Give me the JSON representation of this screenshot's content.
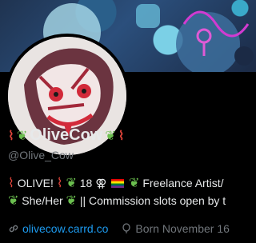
{
  "profile": {
    "display_name": "OliveCow",
    "handle": "@Olive_Cow",
    "bio_line1": {
      "name": "OLIVE!",
      "age": "18",
      "gender_symbol": "⚢",
      "role": "Freelance Artist/"
    },
    "bio_line2": {
      "pronouns": "She/Her",
      "rest": "|| Commission slots open by t"
    },
    "website": "olivecow.carrd.co",
    "born": "Born November 16"
  },
  "icons": {
    "pepper": "hot-pepper-icon",
    "herb": "herb-icon",
    "flag": "rainbow-flag-icon",
    "link": "link-icon",
    "balloon": "birthday-balloon-icon"
  },
  "colors": {
    "background": "#000000",
    "text": "#e7e9ea",
    "muted": "#71767b",
    "link": "#1d9bf0"
  }
}
